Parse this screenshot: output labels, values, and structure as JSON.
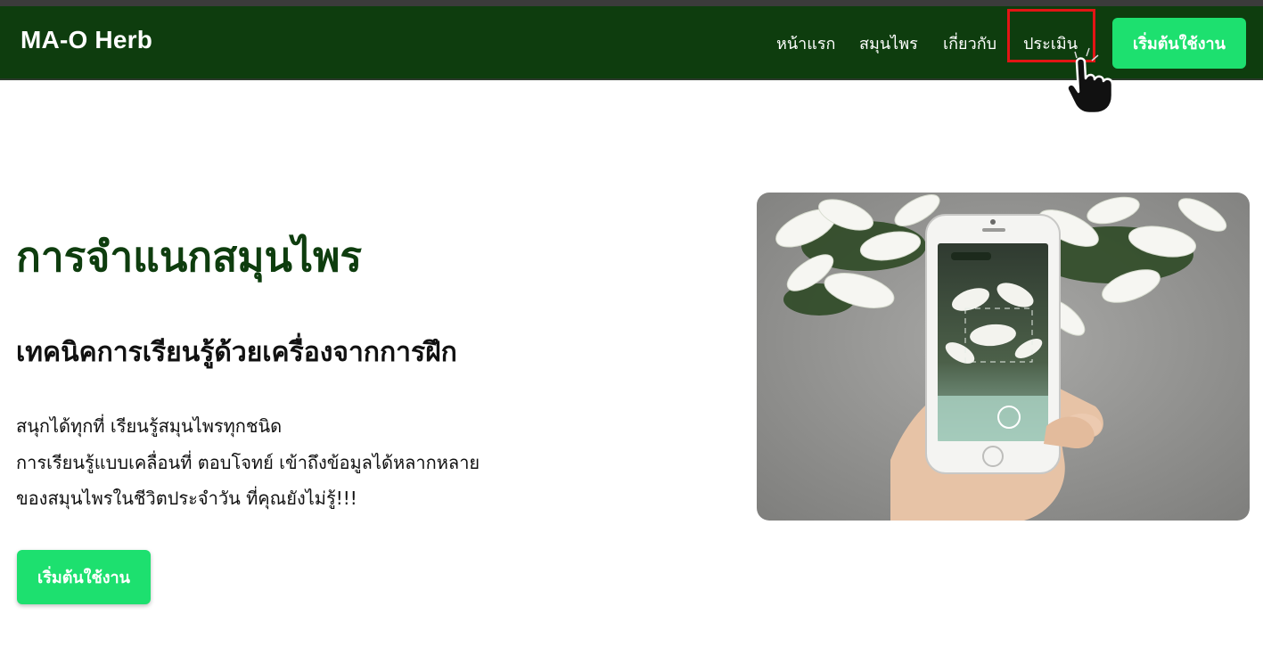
{
  "navbar": {
    "brand": "MA-O Herb",
    "links": [
      "หน้าแรก",
      "สมุนไพร",
      "เกี่ยวกับ",
      "ประเมิน"
    ],
    "cta_label": "เริ่มต้นใช้งาน",
    "bg_color": "#0e3d0e",
    "highlighted_link": "ประเมิน"
  },
  "hero": {
    "title": "การจำแนกสมุนไพร",
    "subtitle": "เทคนิคการเรียนรู้ด้วยเครื่องจากการฝึก",
    "lines": [
      "สนุกได้ทุกที่ เรียนรู้สมุนไพรทุกชนิด",
      "การเรียนรู้แบบเคลื่อนที่ ตอบโจทย์ เข้าถึงข้อมูลได้หลากหลาย",
      "ของสมุนไพรในชีวิตประจำวัน ที่คุณยังไม่รู้!!!"
    ],
    "cta_label": "เริ่มต้นใช้งาน",
    "accent_color": "#1de06f",
    "image_icon": "phone-scanning-flowers-photo"
  }
}
